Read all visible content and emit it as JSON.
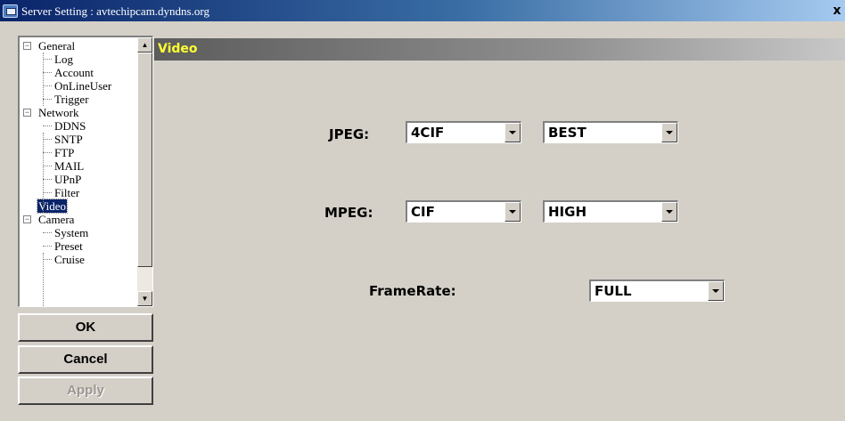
{
  "window": {
    "title": "Server Setting : avtechipcam.dyndns.org",
    "close_glyph": "x"
  },
  "tree": {
    "groups": [
      {
        "label": "General",
        "expander": "−",
        "items": [
          "Log",
          "Account",
          "OnLineUser",
          "Trigger"
        ]
      },
      {
        "label": "Network",
        "expander": "−",
        "items": [
          "DDNS",
          "SNTP",
          "FTP",
          "MAIL",
          "UPnP",
          "Filter"
        ]
      },
      {
        "label": "Video",
        "selected": true
      },
      {
        "label": "Camera",
        "expander": "−",
        "items": [
          "System",
          "Preset",
          "Cruise"
        ]
      }
    ]
  },
  "buttons": {
    "ok": "OK",
    "cancel": "Cancel",
    "apply": "Apply"
  },
  "section": {
    "title": "Video"
  },
  "form": {
    "jpeg": {
      "label": "JPEG:",
      "resolution": "4CIF",
      "quality": "BEST"
    },
    "mpeg": {
      "label": "MPEG:",
      "resolution": "CIF",
      "quality": "HIGH"
    },
    "framerate": {
      "label": "FrameRate:",
      "value": "FULL"
    }
  },
  "icons": [
    "app-icon",
    "close-icon",
    "scroll-up-icon",
    "scroll-down-icon",
    "dropdown-arrow-icon"
  ]
}
